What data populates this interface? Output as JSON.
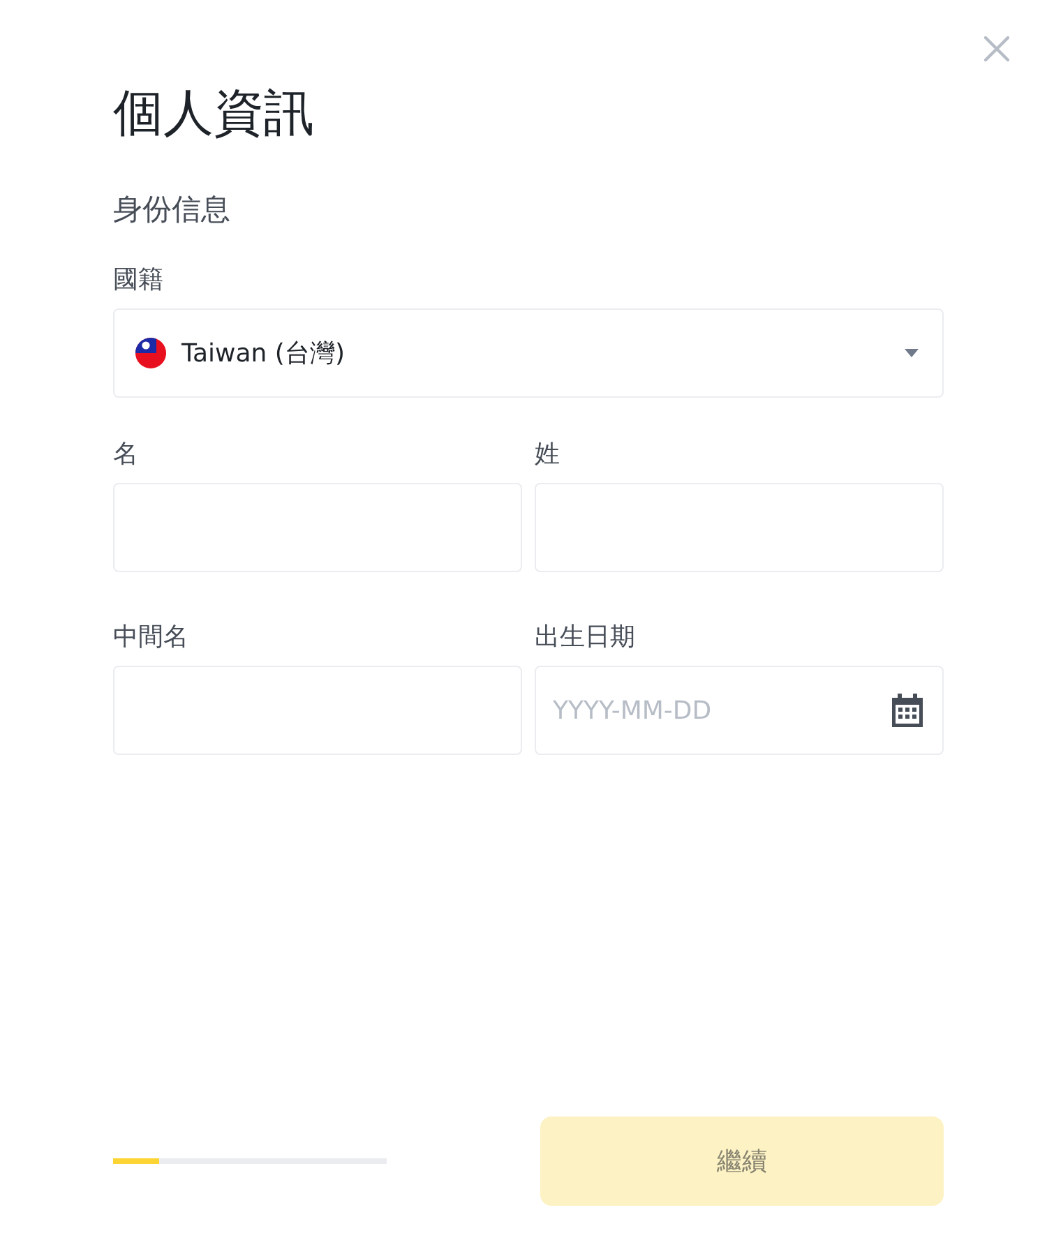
{
  "dialog": {
    "title": "個人資訊",
    "section_title": "身份信息"
  },
  "nationality": {
    "label": "國籍",
    "value": "Taiwan (台灣)"
  },
  "fields": [
    {
      "label": "名",
      "kind": "text"
    },
    {
      "label": "姓",
      "kind": "text"
    },
    {
      "label": "中間名",
      "kind": "text"
    },
    {
      "label": "出生日期",
      "kind": "date",
      "placeholder": "YYYY-MM-DD"
    }
  ],
  "progress": {
    "level": 0.17
  },
  "continue_button": {
    "label": "繼續",
    "disabled": true
  }
}
